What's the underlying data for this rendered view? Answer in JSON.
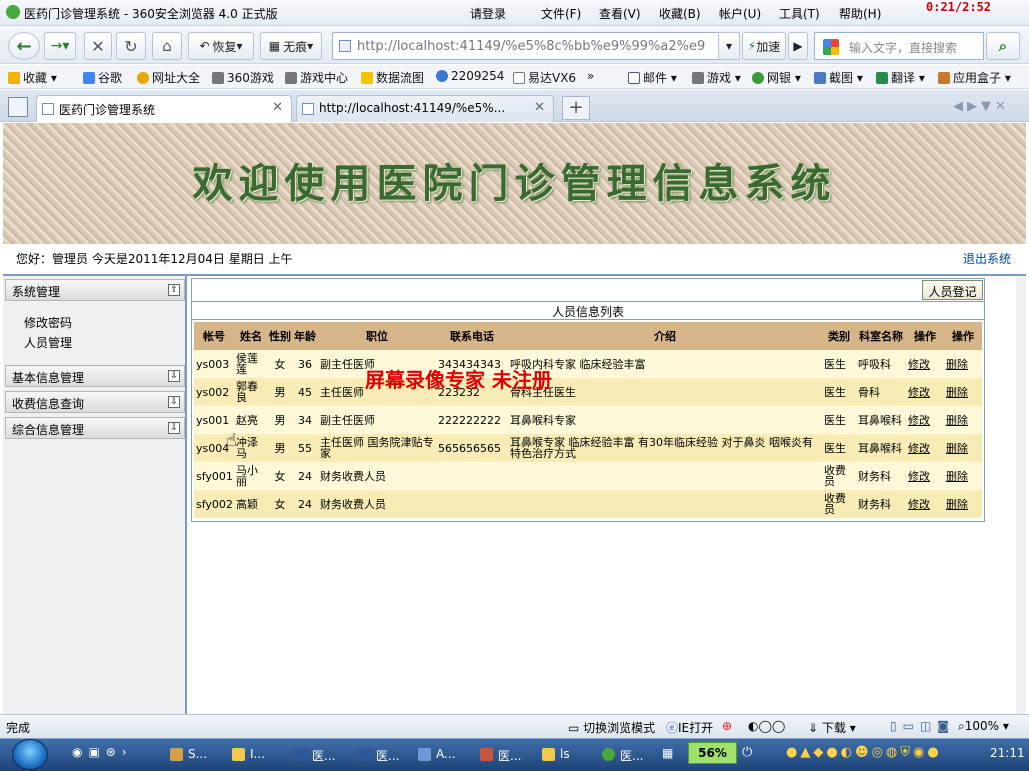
{
  "browser": {
    "window_title": "医药门诊管理系统 - 360安全浏览器 4.0 正式版",
    "title_menu": [
      "请登录",
      "文件(F)",
      "查看(V)",
      "收藏(B)",
      "帐户(U)",
      "工具(T)",
      "帮助(H)"
    ],
    "timer": "0:21/2:52",
    "nav": {
      "restore": "恢复",
      "incognito": "无痕",
      "accelerate": "加速"
    },
    "address": "http://localhost:41149/%e5%8c%bb%e9%99%a2%e9",
    "search_placeholder": "输入文字，直接搜索",
    "bookmarks": [
      "收藏",
      "谷歌",
      "网址大全",
      "360游戏",
      "游戏中心",
      "数据流图",
      "2209254",
      "易达VX6",
      "»",
      "邮件",
      "游戏",
      "网银",
      "截图",
      "翻译",
      "应用盒子"
    ],
    "tabs": [
      {
        "label": "医药门诊管理系统"
      },
      {
        "label": "http://localhost:41149/%e5%..."
      }
    ],
    "status": {
      "left": "完成",
      "switch_mode": "切换浏览模式",
      "ie_open": "IE打开",
      "download": "下载",
      "zoom": "100%"
    }
  },
  "app": {
    "banner_title": "欢迎使用医院门诊管理信息系统",
    "greeting": "您好：管理员    今天是2011年12月04日    星期日    上午",
    "logout": "退出系统",
    "sidebar": {
      "groups": [
        {
          "label": "系统管理",
          "items": [
            "修改密码",
            "人员管理"
          ]
        },
        {
          "label": "基本信息管理"
        },
        {
          "label": "收费信息查询"
        },
        {
          "label": "综合信息管理"
        }
      ]
    },
    "register_button": "人员登记",
    "list_title": "人员信息列表",
    "table": {
      "headers": [
        "帐号",
        "姓名",
        "性别",
        "年龄",
        "职位",
        "联系电话",
        "介绍",
        "类别",
        "科室名称",
        "操作",
        "操作"
      ],
      "rows": [
        [
          "ys003",
          "侯莲莲",
          "女",
          "36",
          "副主任医师",
          "343434343",
          "呼吸内科专家  临床经验丰富",
          "医生",
          "呼吸科",
          "修改",
          "删除"
        ],
        [
          "ys002",
          "郭春良",
          "男",
          "45",
          "主任医师",
          "223232",
          "骨科主任医生",
          "医生",
          "骨科",
          "修改",
          "删除"
        ],
        [
          "ys001",
          "赵亮",
          "男",
          "34",
          "副主任医师",
          "222222222",
          "耳鼻喉科专家",
          "医生",
          "耳鼻喉科",
          "修改",
          "删除"
        ],
        [
          "ys004",
          "冲泽马",
          "男",
          "55",
          "主任医师  国务院津贴专家",
          "565656565",
          "耳鼻喉专家  临床经验丰富  有30年临床经验  对于鼻炎  咽喉炎有特色治疗方式",
          "医生",
          "耳鼻喉科",
          "修改",
          "删除"
        ],
        [
          "sfy001",
          "马小丽",
          "女",
          "24",
          "财务收费人员",
          "",
          "",
          "收费员",
          "财务科",
          "修改",
          "删除"
        ],
        [
          "sfy002",
          "高颖",
          "女",
          "24",
          "财务收费人员",
          "",
          "",
          "收费员",
          "财务科",
          "修改",
          "删除"
        ]
      ]
    },
    "watermark": "屏幕录像专家  未注册"
  },
  "taskbar": {
    "items": [
      "S...",
      "I...",
      "医...",
      "医...",
      "A...",
      "医...",
      "ls",
      "医..."
    ],
    "percent": "56%",
    "clock": "21:11"
  }
}
